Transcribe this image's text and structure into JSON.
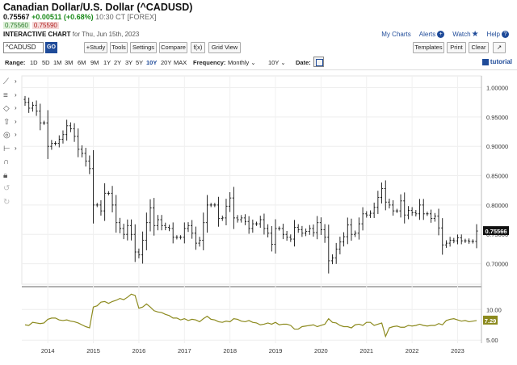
{
  "header": {
    "title": "Canadian Dollar/U.S. Dollar (^CADUSD)",
    "last": "0.75567",
    "change": "+0.00511 (+0.68%)",
    "time": "10:30 CT [FOREX]",
    "bid": "0.75560",
    "ask": "0.75590",
    "chart_label": "INTERACTIVE CHART",
    "chart_date": "for Thu, Jun 15th, 2023"
  },
  "toplinks": {
    "my_charts": "My Charts",
    "alerts": "Alerts",
    "watch": "Watch",
    "help": "Help",
    "plus": "+",
    "star": "★",
    "help_icon": "?"
  },
  "toolbar": {
    "symbol": "^CADUSD",
    "go": "GO",
    "study": "+Study",
    "tools": "Tools",
    "settings": "Settings",
    "compare": "Compare",
    "fx": "f(x)",
    "grid_view": "Grid View",
    "templates": "Templates",
    "print": "Print",
    "clear": "Clear",
    "expand": "↗"
  },
  "rangebar": {
    "range_label": "Range:",
    "ranges": [
      "1D",
      "5D",
      "1M",
      "3M",
      "6M",
      "9M",
      "1Y",
      "2Y",
      "3Y",
      "5Y",
      "10Y",
      "20Y",
      "MAX"
    ],
    "active_range": "10Y",
    "frequency_label": "Frequency:",
    "frequency": "Monthly",
    "period": "10Y",
    "date_label": "Date:",
    "tutorial": "tutorial"
  },
  "colors": {
    "accent": "#1f4b99",
    "up": "#1a8a1a",
    "ask": "#b02020",
    "indicator": "#8c8a1e",
    "price_label_bg": "#111111"
  },
  "chart_data": [
    {
      "type": "ohlc",
      "title": "",
      "x": [
        "2013-07",
        "2013-08",
        "2013-09",
        "2013-10",
        "2013-11",
        "2013-12",
        "2014-01",
        "2014-02",
        "2014-03",
        "2014-04",
        "2014-05",
        "2014-06",
        "2014-07",
        "2014-08",
        "2014-09",
        "2014-10",
        "2014-11",
        "2014-12",
        "2015-01",
        "2015-02",
        "2015-03",
        "2015-04",
        "2015-05",
        "2015-06",
        "2015-07",
        "2015-08",
        "2015-09",
        "2015-10",
        "2015-11",
        "2015-12",
        "2016-01",
        "2016-02",
        "2016-03",
        "2016-04",
        "2016-05",
        "2016-06",
        "2016-07",
        "2016-08",
        "2016-09",
        "2016-10",
        "2016-11",
        "2016-12",
        "2017-01",
        "2017-02",
        "2017-03",
        "2017-04",
        "2017-05",
        "2017-06",
        "2017-07",
        "2017-08",
        "2017-09",
        "2017-10",
        "2017-11",
        "2017-12",
        "2018-01",
        "2018-02",
        "2018-03",
        "2018-04",
        "2018-05",
        "2018-06",
        "2018-07",
        "2018-08",
        "2018-09",
        "2018-10",
        "2018-11",
        "2018-12",
        "2019-01",
        "2019-02",
        "2019-03",
        "2019-04",
        "2019-05",
        "2019-06",
        "2019-07",
        "2019-08",
        "2019-09",
        "2019-10",
        "2019-11",
        "2019-12",
        "2020-01",
        "2020-02",
        "2020-03",
        "2020-04",
        "2020-05",
        "2020-06",
        "2020-07",
        "2020-08",
        "2020-09",
        "2020-10",
        "2020-11",
        "2020-12",
        "2021-01",
        "2021-02",
        "2021-03",
        "2021-04",
        "2021-05",
        "2021-06",
        "2021-07",
        "2021-08",
        "2021-09",
        "2021-10",
        "2021-11",
        "2021-12",
        "2022-01",
        "2022-02",
        "2022-03",
        "2022-04",
        "2022-05",
        "2022-06",
        "2022-07",
        "2022-08",
        "2022-09",
        "2022-10",
        "2022-11",
        "2022-12",
        "2023-01",
        "2023-02",
        "2023-03",
        "2023-04",
        "2023-05",
        "2023-06"
      ],
      "close": [
        0.975,
        0.965,
        0.97,
        0.96,
        0.94,
        0.94,
        0.9,
        0.905,
        0.905,
        0.912,
        0.92,
        0.935,
        0.93,
        0.917,
        0.895,
        0.888,
        0.875,
        0.862,
        0.8,
        0.8,
        0.79,
        0.82,
        0.82,
        0.8,
        0.77,
        0.76,
        0.75,
        0.765,
        0.75,
        0.72,
        0.715,
        0.74,
        0.77,
        0.795,
        0.765,
        0.775,
        0.765,
        0.762,
        0.76,
        0.745,
        0.745,
        0.745,
        0.76,
        0.765,
        0.752,
        0.735,
        0.74,
        0.77,
        0.8,
        0.8,
        0.8,
        0.777,
        0.778,
        0.798,
        0.812,
        0.778,
        0.775,
        0.778,
        0.772,
        0.76,
        0.768,
        0.768,
        0.775,
        0.76,
        0.752,
        0.733,
        0.76,
        0.76,
        0.75,
        0.745,
        0.742,
        0.762,
        0.758,
        0.752,
        0.755,
        0.76,
        0.753,
        0.77,
        0.758,
        0.745,
        0.705,
        0.71,
        0.725,
        0.737,
        0.746,
        0.766,
        0.75,
        0.752,
        0.768,
        0.785,
        0.783,
        0.786,
        0.796,
        0.813,
        0.828,
        0.805,
        0.8,
        0.79,
        0.79,
        0.807,
        0.783,
        0.791,
        0.787,
        0.785,
        0.8,
        0.785,
        0.785,
        0.777,
        0.781,
        0.761,
        0.732,
        0.735,
        0.74,
        0.739,
        0.744,
        0.739,
        0.739,
        0.738,
        0.738,
        0.7557
      ],
      "ylim": [
        0.665,
        1.02
      ],
      "y_ticks": [
        "1.00000",
        "0.95000",
        "0.90000",
        "0.85000",
        "0.80000",
        "0.75000",
        "0.70000"
      ],
      "x_ticks": [
        "2014",
        "2015",
        "2016",
        "2017",
        "2018",
        "2019",
        "2020",
        "2021",
        "2022",
        "2023"
      ],
      "last_price_label": "0.75566"
    },
    {
      "type": "line",
      "title": "",
      "series": [
        {
          "values": [
            7.5,
            7.4,
            7.9,
            7.8,
            7.7,
            7.8,
            8.4,
            8.6,
            8.6,
            8.3,
            8.2,
            8.3,
            8.1,
            8.0,
            7.8,
            7.5,
            7.2,
            7.0,
            10.4,
            10.6,
            11.2,
            11.3,
            11.0,
            11.3,
            11.5,
            11.8,
            11.6,
            12.0,
            12.5,
            12.3,
            10.2,
            10.4,
            10.9,
            10.4,
            9.8,
            9.6,
            9.5,
            9.2,
            9.0,
            8.6,
            8.6,
            8.3,
            8.5,
            8.2,
            8.4,
            8.3,
            8.0,
            8.5,
            8.9,
            8.4,
            8.3,
            8.0,
            7.9,
            8.1,
            8.0,
            8.5,
            8.4,
            8.1,
            8.0,
            8.2,
            7.9,
            7.8,
            7.5,
            7.6,
            7.8,
            7.6,
            7.9,
            7.5,
            7.6,
            7.6,
            7.4,
            6.8,
            6.8,
            7.2,
            7.3,
            7.4,
            7.5,
            7.2,
            7.4,
            7.6,
            8.5,
            7.9,
            7.8,
            7.4,
            7.2,
            7.2,
            7.0,
            7.5,
            7.6,
            7.4,
            7.9,
            7.9,
            7.4,
            7.6,
            7.8,
            5.6,
            7.0,
            7.2,
            7.3,
            7.1,
            7.1,
            7.4,
            7.3,
            7.4,
            7.6,
            7.4,
            7.3,
            7.4,
            7.4,
            7.7,
            7.5,
            8.2,
            8.4,
            8.5,
            8.3,
            8.1,
            8.2,
            8.0,
            8.1,
            8.2
          ]
        }
      ],
      "ylim": [
        4.5,
        12.8
      ],
      "y_ticks": [
        "10.00",
        "5.00"
      ],
      "last_value_label": "7.29"
    }
  ]
}
